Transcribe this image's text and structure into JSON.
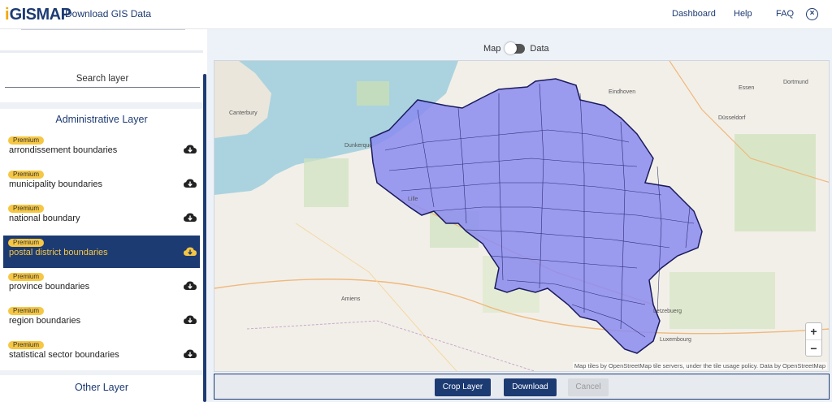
{
  "header": {
    "logo_i": "i",
    "logo_text": "GISMAP",
    "title": "Download GIS Data",
    "nav": [
      "Dashboard",
      "Help",
      "FAQ"
    ],
    "close_icon": "⊗"
  },
  "sidebar": {
    "search_placeholder": "Search layer",
    "admin_title": "Administrative Layer",
    "layers": [
      {
        "badge": "Premium",
        "label": "arrondissement boundaries",
        "active": false
      },
      {
        "badge": "Premium",
        "label": "municipality boundaries",
        "active": false
      },
      {
        "badge": "Premium",
        "label": "national boundary",
        "active": false
      },
      {
        "badge": "Premium",
        "label": "postal district boundaries",
        "active": true
      },
      {
        "badge": "Premium",
        "label": "province boundaries",
        "active": false
      },
      {
        "badge": "Premium",
        "label": "region boundaries",
        "active": false
      },
      {
        "badge": "Premium",
        "label": "statistical sector boundaries",
        "active": false
      }
    ],
    "other_title": "Other Layer"
  },
  "map": {
    "toggle_left": "Map",
    "toggle_right": "Data",
    "zoom_in": "+",
    "zoom_out": "−",
    "attribution": "Map tiles by OpenStreetMap tile servers, under the tile usage policy. Data by OpenStreetMap",
    "place_labels": [
      "Canterbury",
      "Dunkerque",
      "Lille",
      "Amiens",
      "Eindhoven",
      "Dortmund",
      "Essen",
      "Düsseldorf",
      "Luxembourg",
      "Letzebuerg"
    ],
    "colors": {
      "sea": "#aad3df",
      "land": "#f2efe9",
      "selection": "#8b8bf0",
      "selection_stroke": "#1a1a5e"
    }
  },
  "actions": {
    "crop": "Crop Layer",
    "download": "Download",
    "cancel": "Cancel"
  },
  "colors": {
    "brand": "#1d3b73",
    "accent": "#f6c744"
  }
}
